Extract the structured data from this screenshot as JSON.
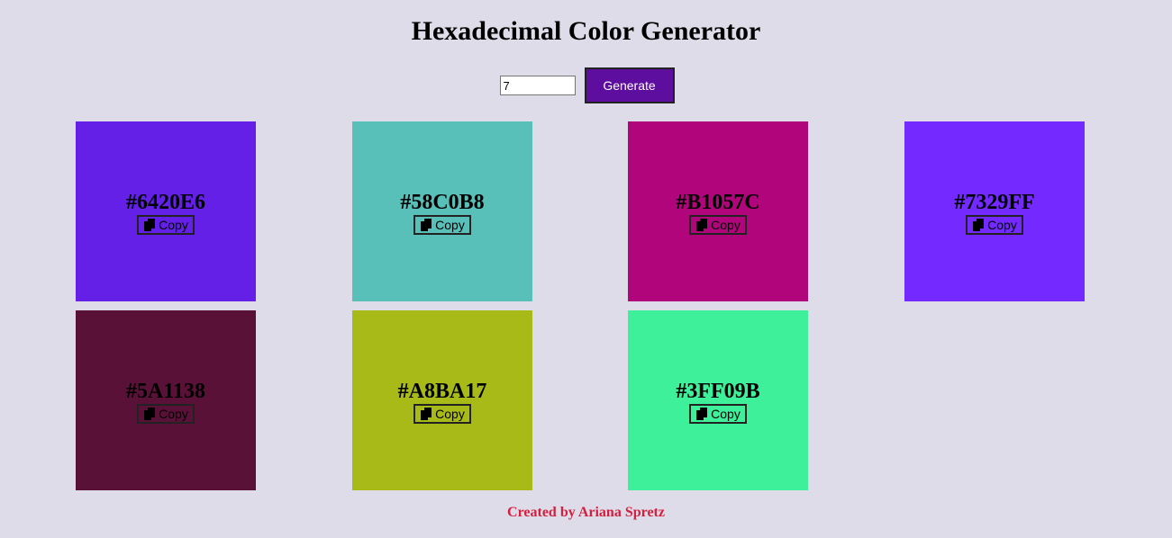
{
  "title": "Hexadecimal Color Generator",
  "controls": {
    "count_value": "7",
    "generate_label": "Generate",
    "generate_color": "#5e0e9e"
  },
  "swatches": [
    {
      "hex": "#6420E6",
      "color": "#6420E6",
      "copy_label": "Copy",
      "icon": "copy-icon"
    },
    {
      "hex": "#58C0B8",
      "color": "#58C0B8",
      "copy_label": "Copy",
      "icon": "copy-icon"
    },
    {
      "hex": "#B1057C",
      "color": "#B1057C",
      "copy_label": "Copy",
      "icon": "copy-icon"
    },
    {
      "hex": "#7329FF",
      "color": "#7329FF",
      "copy_label": "Copy",
      "icon": "copy-icon"
    },
    {
      "hex": "#5A1138",
      "color": "#5A1138",
      "copy_label": "Copy",
      "icon": "copy-icon"
    },
    {
      "hex": "#A8BA17",
      "color": "#A8BA17",
      "copy_label": "Copy",
      "icon": "copy-icon"
    },
    {
      "hex": "#3FF09B",
      "color": "#3FF09B",
      "copy_label": "Copy",
      "icon": "copy-icon"
    }
  ],
  "footer": "Created by Ariana Spretz",
  "colors": {
    "background": "#dedce8",
    "footer_text": "#d41f3f"
  }
}
